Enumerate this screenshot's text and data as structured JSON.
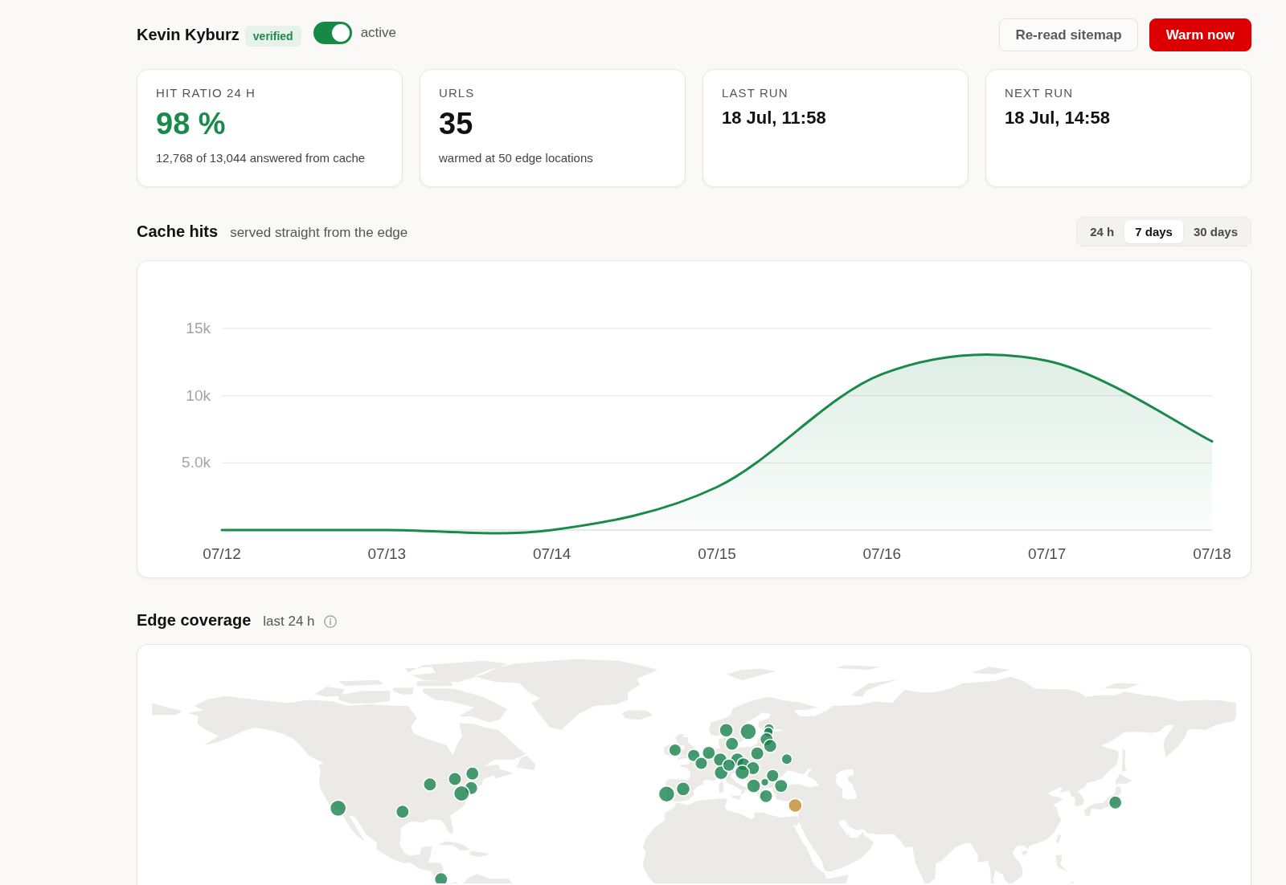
{
  "header": {
    "name": "Kevin Kyburz",
    "badge": "verified",
    "toggle": {
      "on": true,
      "label": "active"
    },
    "buttons": [
      {
        "label": "Re-read sitemap",
        "kind": "secondary"
      },
      {
        "label": "Warm now",
        "kind": "primary"
      }
    ]
  },
  "stats": [
    {
      "label": "HIT RATIO 24 H",
      "value": "98 %",
      "note": "12,768 of 13,044 answered from cache",
      "kind": "positive"
    },
    {
      "label": "URLS",
      "value": "35",
      "note": "warmed at 50 edge locations",
      "kind": "count"
    },
    {
      "label": "LAST RUN",
      "value": "18 Jul, 11:58",
      "kind": "time"
    },
    {
      "label": "NEXT RUN",
      "value": "18 Jul, 14:58",
      "kind": "time"
    }
  ],
  "cache_hits": {
    "title": "Cache hits",
    "subtitle": "served straight from the edge",
    "range_tabs": [
      {
        "label": "24 h",
        "selected": false
      },
      {
        "label": "7 days",
        "selected": true
      },
      {
        "label": "30 days",
        "selected": false
      }
    ],
    "chart_data": {
      "type": "area",
      "categories": [
        "07/12",
        "07/13",
        "07/14",
        "07/15",
        "07/16",
        "07/17",
        "07/18"
      ],
      "values": [
        0,
        0,
        0,
        3200,
        11600,
        12600,
        6600
      ],
      "color": "#1a8a4a",
      "yticks": [
        {
          "value": 5000,
          "label": "5.0k"
        },
        {
          "value": 10000,
          "label": "10k"
        },
        {
          "value": 15000,
          "label": "15k"
        }
      ],
      "ylim": [
        0,
        15000
      ],
      "grid": true
    }
  },
  "edge_coverage": {
    "title": "Edge coverage",
    "subtitle": "last 24 h"
  }
}
